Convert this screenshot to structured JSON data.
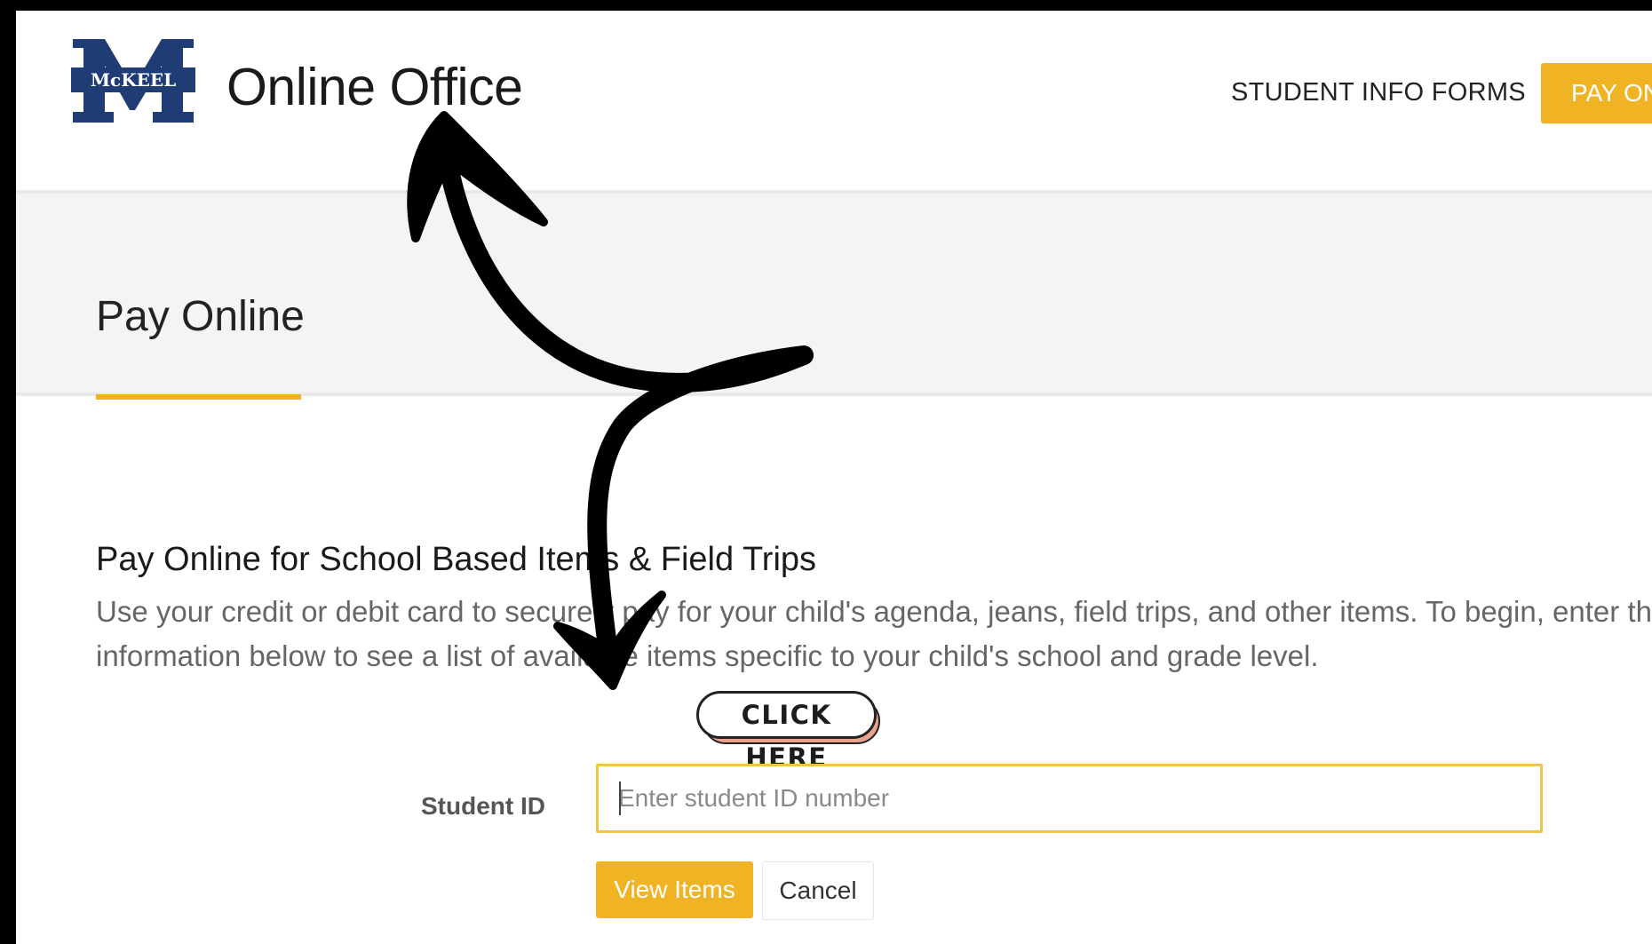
{
  "header": {
    "logo_text": "McKEEL",
    "title": "Online Office",
    "nav_forms": "STUDENT INFO FORMS",
    "nav_pay": "PAY ONLINE"
  },
  "banner": {
    "title": "Pay Online"
  },
  "section": {
    "heading": "Pay Online for School Based Items & Field Trips",
    "desc_line1": "Use your credit or debit card to securely pay for your child's agenda, jeans, field trips, and other items. To begin, enter the",
    "desc_line2": "information below to see a list of available items specific to your child's school and grade level."
  },
  "annotation": {
    "click_here": "CLICK HERE"
  },
  "form": {
    "student_id_label": "Student ID",
    "student_id_placeholder": "Enter student ID number",
    "view_items": "View Items",
    "cancel": "Cancel"
  },
  "colors": {
    "accent": "#f0b323",
    "logo_navy": "#1f3c74"
  }
}
